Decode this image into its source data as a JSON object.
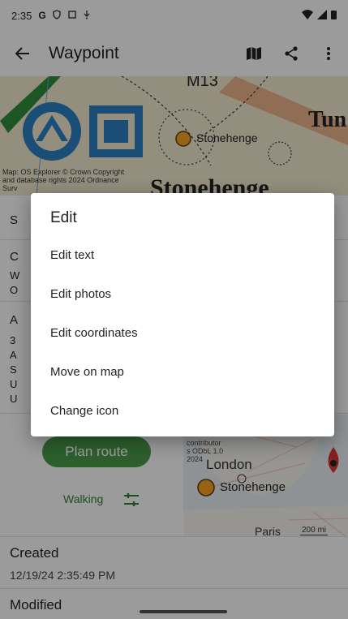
{
  "status_bar": {
    "time": "2:35",
    "g_glyph": "G"
  },
  "app_bar": {
    "title": "Waypoint",
    "back_icon": "arrow-back-icon",
    "actions": [
      "map-icon",
      "share-icon",
      "more-vert-icon"
    ]
  },
  "map": {
    "place_label": "Stonehenge",
    "attribution_lines": [
      "Map: OS Explorer © Crown Copyright",
      "and database rights 2024 Ordnance",
      "Surv"
    ]
  },
  "sections": {
    "letters": [
      "S",
      "C",
      "W",
      "O",
      "A",
      "3",
      "A",
      "S",
      "U",
      "U"
    ]
  },
  "route": {
    "plan_route_label": "Plan route",
    "mode_label": "Walking",
    "tune_icon": "tune-icon"
  },
  "minimap": {
    "attribution": [
      "contributor",
      "s ODbL 1.0",
      "2024"
    ],
    "city_label": "London",
    "place_label": "Stonehenge",
    "city_label_2": "Paris",
    "scale_label": "200 mi"
  },
  "created": {
    "label": "Created",
    "value": "12/19/24 2:35:49 PM"
  },
  "modified": {
    "label": "Modified"
  },
  "dialog": {
    "title": "Edit",
    "items": [
      "Edit text",
      "Edit photos",
      "Edit coordinates",
      "Move on map",
      "Change icon"
    ]
  },
  "colors": {
    "accent_green": "#4a9a4a",
    "marker_orange": "#f0a020",
    "scrim": "rgba(0,0,0,0.38)"
  }
}
